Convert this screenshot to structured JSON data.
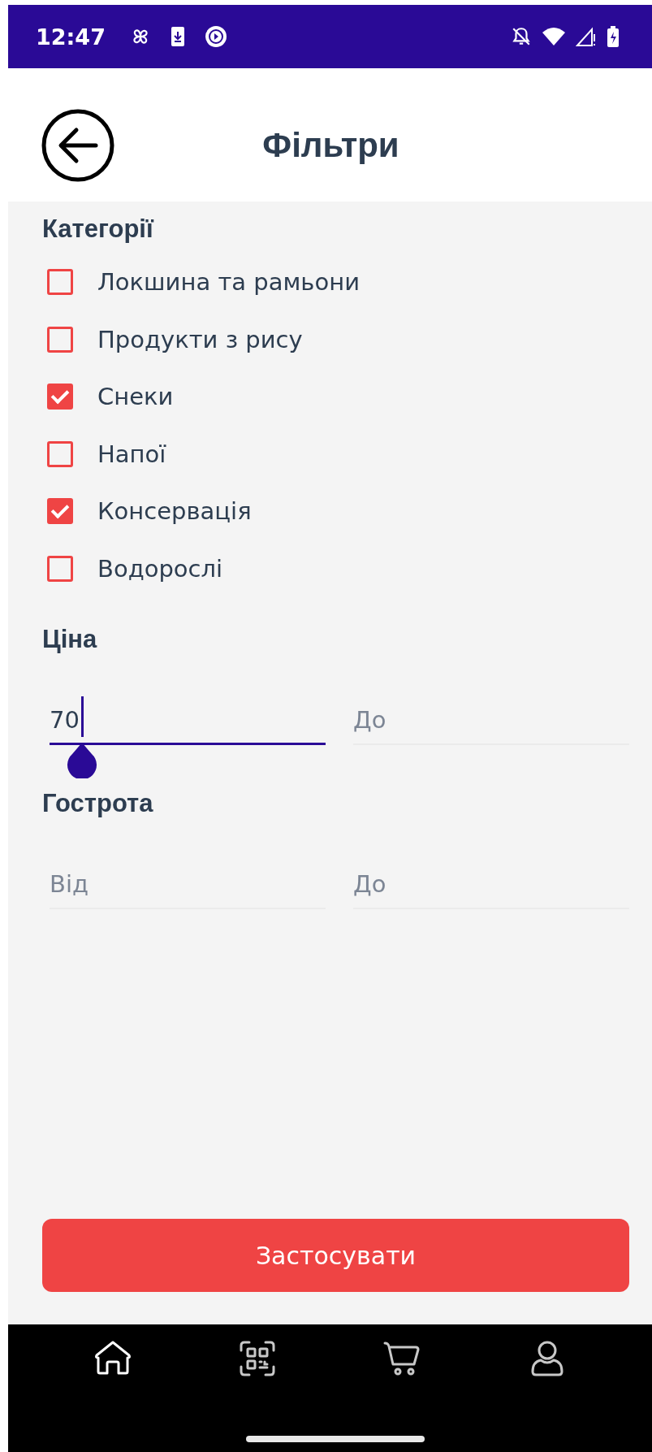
{
  "status_bar": {
    "time": "12:47"
  },
  "header": {
    "title": "Фільтри"
  },
  "categories": {
    "title": "Категорії",
    "items": [
      {
        "label": "Локшина та рамьони",
        "checked": false
      },
      {
        "label": "Продукти з рису",
        "checked": false
      },
      {
        "label": "Снеки",
        "checked": true
      },
      {
        "label": "Напої",
        "checked": false
      },
      {
        "label": "Консервація",
        "checked": true
      },
      {
        "label": "Водорослі",
        "checked": false
      }
    ]
  },
  "price": {
    "title": "Ціна",
    "fields": [
      {
        "value": "70",
        "focused": true
      },
      {
        "placeholder": "До",
        "focused": false
      }
    ]
  },
  "spiciness": {
    "title": "Гострота",
    "fields": [
      {
        "placeholder": "Від",
        "focused": false
      },
      {
        "placeholder": "До",
        "focused": false
      }
    ]
  },
  "apply_button": {
    "label": "Застосувати"
  },
  "nav": {
    "items": [
      {
        "kind": "home",
        "selected": true
      },
      {
        "kind": "qr",
        "selected": false
      },
      {
        "kind": "cart",
        "selected": false
      },
      {
        "kind": "profile",
        "selected": false
      }
    ]
  }
}
